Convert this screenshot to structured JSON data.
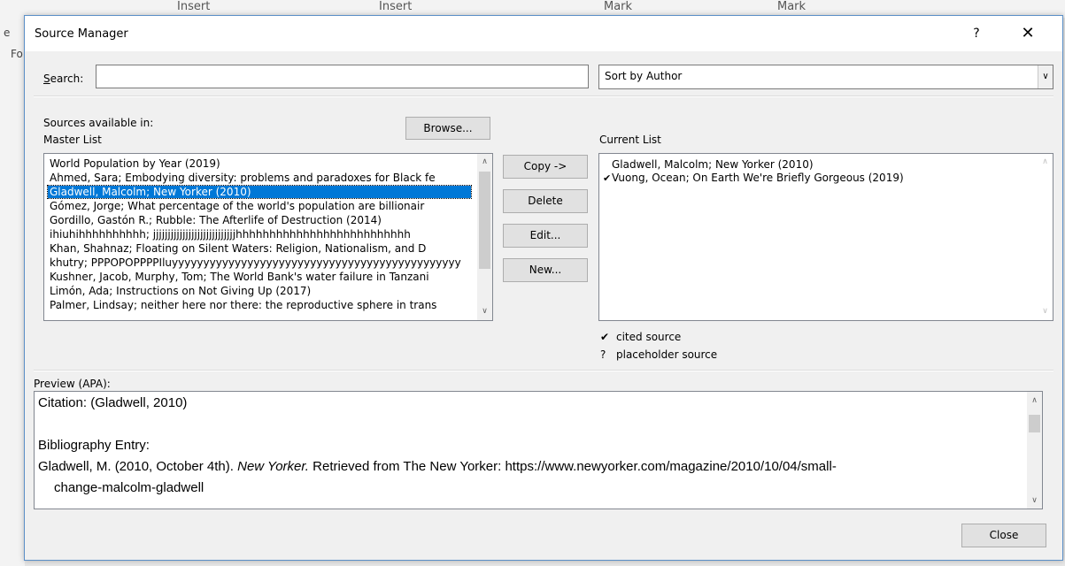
{
  "background": {
    "tabs": [
      "Insert",
      "Insert",
      "Mark",
      "Mark"
    ],
    "left_labels": [
      "e",
      "Fo"
    ]
  },
  "dialog": {
    "title": "Source Manager",
    "help_label": "?",
    "close_glyph": "✕"
  },
  "search": {
    "label": "Search:",
    "value": "",
    "sort_value": "Sort by Author",
    "sort_arrow": "∨"
  },
  "master": {
    "sources_label": "Sources available in:",
    "list_label": "Master List",
    "browse_label": "Browse...",
    "items": [
      "World Population by Year (2019)",
      "Ahmed, Sara; Embodying diversity: problems and paradoxes for Black fe",
      "Gladwell, Malcolm; New Yorker (2010)",
      "Gómez, Jorge; What percentage of the world's population are billionair",
      "Gordillo, Gastón R.; Rubble: The Afterlife of Destruction (2014)",
      "ihiuhihhhhhhhhhh; jjjjjjjjjjjjjjjjjjjjjjjjjjjjhhhhhhhhhhhhhhhhhhhhhhhhhh",
      "Khan, Shahnaz; Floating on Silent Waters: Religion, Nationalism, and D",
      "khutry; PPPOPOPPPPIluyyyyyyyyyyyyyyyyyyyyyyyyyyyyyyyyyyyyyyyyyyyyyy",
      "Kushner, Jacob, Murphy, Tom; The World Bank's water failure in Tanzani",
      "Limón, Ada; Instructions on Not Giving Up (2017)",
      "Palmer, Lindsay; neither here nor there: the reproductive sphere in trans"
    ],
    "selected_index": 2
  },
  "actions": {
    "copy": "Copy ->",
    "delete": "Delete",
    "edit": "Edit...",
    "new": "New..."
  },
  "current": {
    "label": "Current List",
    "items": [
      {
        "mark": "",
        "text": "Gladwell, Malcolm; New Yorker (2010)"
      },
      {
        "mark": "✔",
        "text": "Vuong, Ocean; On Earth We're Briefly Gorgeous (2019)"
      }
    ],
    "legend": [
      {
        "symbol": "✔",
        "text": "cited source"
      },
      {
        "symbol": "?",
        "text": "placeholder source"
      }
    ]
  },
  "preview": {
    "label": "Preview (APA):",
    "citation": "Citation:  (Gladwell, 2010)",
    "bib_heading": "Bibliography Entry:",
    "bib_pre": "Gladwell, M. (2010, October 4th). ",
    "bib_italic": "New Yorker.",
    "bib_post": " Retrieved from The New Yorker: https://www.newyorker.com/magazine/2010/10/04/small-",
    "bib_cont": "change-malcolm-gladwell"
  },
  "footer": {
    "close_label": "Close"
  }
}
